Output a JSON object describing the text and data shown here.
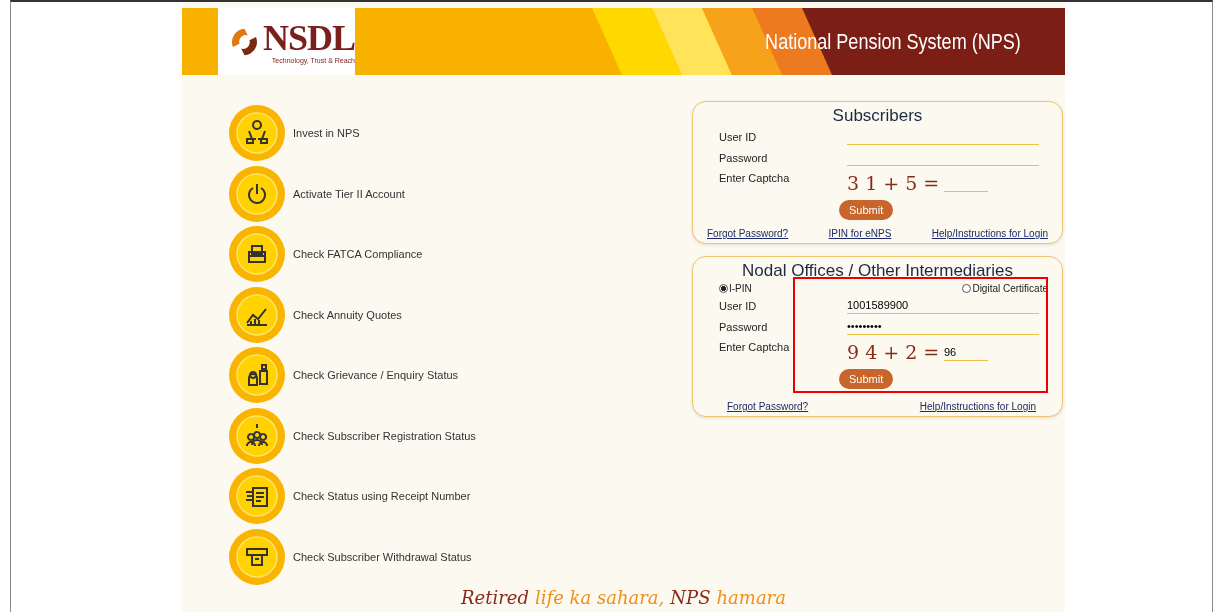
{
  "header": {
    "logo": {
      "name": "NSDL",
      "tagline": "Technology, Trust & Reach"
    },
    "title": "National Pension System (NPS)"
  },
  "services": [
    {
      "label": "Invest in NPS"
    },
    {
      "label": "Activate Tier II Account"
    },
    {
      "label": "Check FATCA Compliance"
    },
    {
      "label": "Check Annuity Quotes"
    },
    {
      "label": "Check Grievance / Enquiry Status"
    },
    {
      "label": "Check Subscriber Registration Status"
    },
    {
      "label": "Check Status using Receipt Number"
    },
    {
      "label": "Check Subscriber Withdrawal Status"
    }
  ],
  "subscribers": {
    "title": "Subscribers",
    "fields": [
      {
        "label": "User ID"
      },
      {
        "label": "Password"
      }
    ],
    "captcha": {
      "label": "Enter Captcha",
      "image_text": "3 1 + 5 ="
    },
    "submit": "Submit",
    "links": [
      "Forgot Password?",
      "IPIN for eNPS",
      "Help/Instructions for Login"
    ]
  },
  "nodal": {
    "title": "Nodal Offices / Other Intermediaries",
    "highlighted": true,
    "login_modes": [
      {
        "label": "I-PIN",
        "selected": true
      },
      {
        "label": "Digital Certificate",
        "selected": false
      }
    ],
    "fields": [
      {
        "label": "User ID",
        "value": "1001589900"
      },
      {
        "label": "Password",
        "value": "•••••••••"
      }
    ],
    "captcha": {
      "label": "Enter Captcha",
      "image_text": "9 4 + 2 =",
      "value": "96"
    },
    "submit": "Submit",
    "links": [
      "Forgot Password?",
      "Help/Instructions for Login"
    ]
  },
  "tagline": [
    {
      "text": "Retired",
      "color": "#8b2a1c"
    },
    {
      "text": "life ka sahara,",
      "color": "#f0901a"
    },
    {
      "text": "NPS",
      "color": "#8b2a1c"
    },
    {
      "text": "hamara",
      "color": "#f0901a"
    }
  ]
}
